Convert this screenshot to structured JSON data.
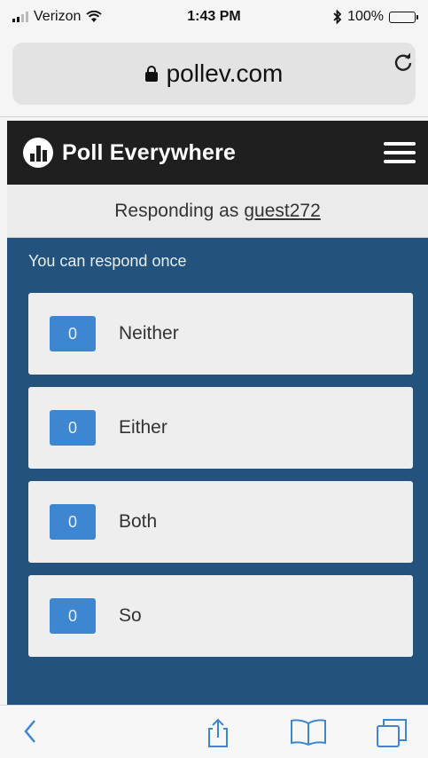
{
  "status_bar": {
    "carrier": "Verizon",
    "time": "1:43 PM",
    "battery": "100%"
  },
  "browser": {
    "url": "pollev.com"
  },
  "site": {
    "brand": "Poll Everywhere"
  },
  "responding": {
    "prefix": "Responding as",
    "username": "guest272"
  },
  "poll": {
    "instruction": "You can respond once",
    "options": [
      {
        "count": "0",
        "label": "Neither"
      },
      {
        "count": "0",
        "label": "Either"
      },
      {
        "count": "0",
        "label": "Both"
      },
      {
        "count": "0",
        "label": "So"
      }
    ]
  },
  "colors": {
    "header_bg": "#1f1f1f",
    "poll_bg": "#23527c",
    "count_badge": "#3f86d0",
    "toolbar_icon": "#3f86d0"
  },
  "icons": {
    "lock": "lock-icon",
    "reload": "reload-icon",
    "menu": "hamburger-menu-icon",
    "back": "chevron-left-icon",
    "share": "share-icon",
    "bookmarks": "book-icon",
    "tabs": "tabs-icon"
  }
}
